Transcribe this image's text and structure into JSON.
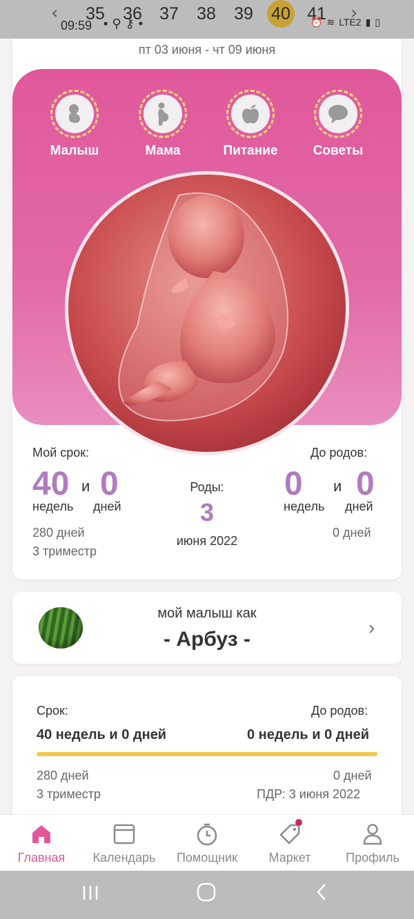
{
  "status_bar": {
    "time": "09:59",
    "weeks": [
      "35",
      "36",
      "37",
      "38",
      "39",
      "40",
      "41"
    ],
    "active_week": "40",
    "network": "LTE2"
  },
  "header": {
    "date_range": "пт 03 июня - чт 09 июня"
  },
  "categories": [
    {
      "label": "Малыш",
      "icon": "baby-icon"
    },
    {
      "label": "Мама",
      "icon": "pregnant-woman-icon"
    },
    {
      "label": "Питание",
      "icon": "apple-icon"
    },
    {
      "label": "Советы",
      "icon": "speech-bubble-icon"
    }
  ],
  "term": {
    "label": "Мой срок:",
    "weeks": "40",
    "and": "и",
    "days": "0",
    "weeks_unit": "недель",
    "days_unit": "дней",
    "total_days": "280 дней",
    "trimester": "3 триместр"
  },
  "birth": {
    "label": "Роды:",
    "day": "3",
    "month_year": "июня 2022"
  },
  "until": {
    "label": "До родов:",
    "weeks": "0",
    "and": "и",
    "days": "0",
    "weeks_unit": "недель",
    "days_unit": "дней",
    "total_days": "0 дней"
  },
  "fruit": {
    "subtitle": "мой малыш как",
    "name": "- Арбуз -",
    "image": "watermelon"
  },
  "progress": {
    "term_label": "Срок:",
    "term_value": "40 недель и 0 дней",
    "until_label": "До родов:",
    "until_value": "0 недель и 0 дней",
    "fill_fraction": 1.0,
    "total_days": "280 дней",
    "trimester": "3 триместр",
    "until_days": "0 дней",
    "due_date": "ПДР: 3 июня 2022"
  },
  "bottom_nav": [
    {
      "label": "Главная",
      "icon": "home-icon",
      "active": true
    },
    {
      "label": "Календарь",
      "icon": "calendar-icon",
      "active": false
    },
    {
      "label": "Помощник",
      "icon": "timer-icon",
      "active": false
    },
    {
      "label": "Маркет",
      "icon": "tag-icon",
      "active": false
    },
    {
      "label": "Профиль",
      "icon": "profile-icon",
      "active": false
    }
  ],
  "colors": {
    "accent_pink": "#e0589b",
    "number_purple": "#b07bbf",
    "progress_yellow": "#f1c84b",
    "active_week_gold": "#c9a236"
  }
}
